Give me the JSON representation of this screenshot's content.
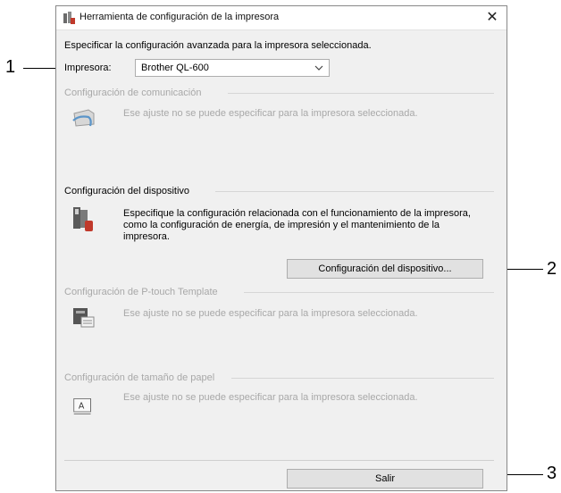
{
  "callouts": [
    "1",
    "2",
    "3"
  ],
  "window": {
    "title": "Herramienta de configuración de la impresora",
    "close_glyph": "✕"
  },
  "intro": "Especificar la configuración avanzada para la impresora seleccionada.",
  "printer": {
    "label": "Impresora:",
    "selected": "Brother QL-600"
  },
  "sections": {
    "communication": {
      "title": "Configuración de comunicación",
      "message": "Ese ajuste no se puede especificar para la impresora seleccionada.",
      "icon": "network-printer-icon"
    },
    "device": {
      "title": "Configuración del dispositivo",
      "description_lines": [
        "Especifique la configuración relacionada con el funcionamiento de la impresora,",
        "como la configuración de energía, de impresión y el mantenimiento de la",
        "impresora."
      ],
      "button": "Configuración del dispositivo...",
      "icon": "printer-settings-icon"
    },
    "template": {
      "title": "Configuración de P-touch Template",
      "message": "Ese ajuste no se puede especificar para la impresora seleccionada.",
      "icon": "template-printer-icon"
    },
    "paper": {
      "title": "Configuración de tamaño de papel",
      "message": "Ese ajuste no se puede especificar para la impresora seleccionada.",
      "icon": "paper-size-icon"
    }
  },
  "exit_button": "Salir",
  "colors": {
    "window_bg": "#f0f0f0",
    "disabled_text": "#a8a8a8",
    "button_bg": "#e1e1e1"
  }
}
